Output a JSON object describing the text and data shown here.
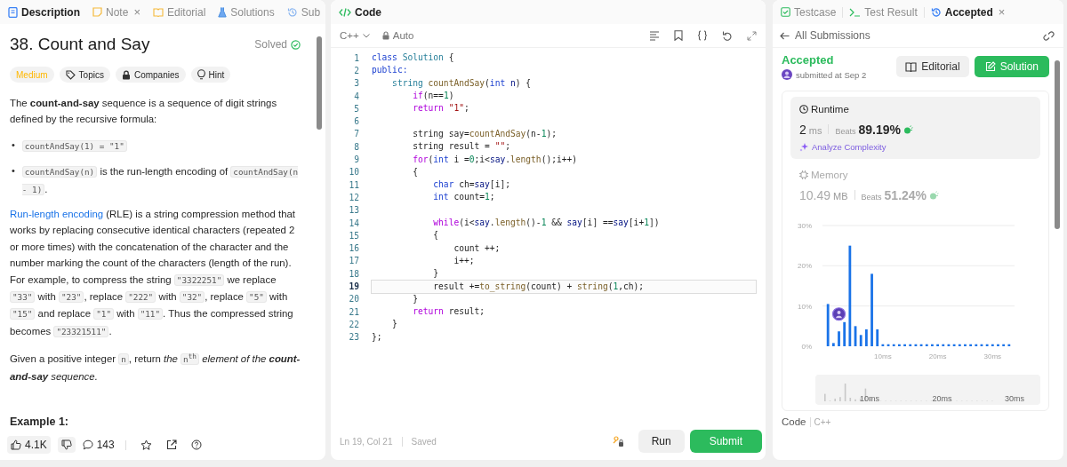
{
  "left_tabs": [
    {
      "kind": "description",
      "label": "Description",
      "selected": true
    },
    {
      "kind": "note",
      "label": "Note",
      "selected": false,
      "close": "×"
    },
    {
      "kind": "editorial",
      "label": "Editorial",
      "selected": false
    },
    {
      "kind": "solutions",
      "label": "Solutions",
      "selected": false
    },
    {
      "kind": "submissions",
      "label": "Sub",
      "selected": false
    }
  ],
  "problem": {
    "title": "38. Count and Say",
    "status": "Solved",
    "tags": [
      {
        "kind": "difficulty",
        "label": "Medium"
      },
      {
        "kind": "topics",
        "label": "Topics"
      },
      {
        "kind": "companies",
        "label": "Companies"
      },
      {
        "kind": "hint",
        "label": "Hint"
      }
    ],
    "intro": [
      {
        "kind": "text",
        "text": "The **count-and-say** sequence is a sequence of digit strings defined by the recursive formula:"
      }
    ],
    "bullets": [
      {
        "marker": "•",
        "segments": [
          {
            "kind": "code",
            "text": "countAndSay(1) = \"1\""
          }
        ]
      },
      {
        "marker": "•",
        "segments": [
          {
            "kind": "code",
            "text": "countAndSay(n)"
          },
          {
            "kind": "text",
            "text": " is the run-length encoding of "
          },
          {
            "kind": "code",
            "text": "countAndSay(n - 1)"
          },
          {
            "kind": "text",
            "text": "."
          }
        ]
      }
    ],
    "paragraphs": [
      [
        {
          "kind": "link",
          "text": "Run-length encoding"
        },
        {
          "kind": "text",
          "text": " (RLE) is a string compression method that works by replacing consecutive identical characters (repeated 2 or more times) with the concatenation of the character and the number marking the count of the characters (length of the run). For example, to compress the string "
        },
        {
          "kind": "code",
          "text": "\"3322251\""
        },
        {
          "kind": "text",
          "text": " we replace "
        },
        {
          "kind": "code",
          "text": "\"33\""
        },
        {
          "kind": "text",
          "text": " with "
        },
        {
          "kind": "code",
          "text": "\"23\""
        },
        {
          "kind": "text",
          "text": ", replace "
        },
        {
          "kind": "code",
          "text": "\"222\""
        },
        {
          "kind": "text",
          "text": " with "
        },
        {
          "kind": "code",
          "text": "\"32\""
        },
        {
          "kind": "text",
          "text": ", replace "
        },
        {
          "kind": "code",
          "text": "\"5\""
        },
        {
          "kind": "text",
          "text": " with "
        },
        {
          "kind": "code",
          "text": "\"15\""
        },
        {
          "kind": "text",
          "text": " and replace "
        },
        {
          "kind": "code",
          "text": "\"1\""
        },
        {
          "kind": "text",
          "text": " with "
        },
        {
          "kind": "code",
          "text": "\"11\""
        },
        {
          "kind": "text",
          "text": ". Thus the compressed string becomes "
        },
        {
          "kind": "code",
          "text": "\"23321511\""
        },
        {
          "kind": "text",
          "text": "."
        }
      ],
      [
        {
          "kind": "text",
          "text": "Given a positive integer "
        },
        {
          "kind": "code",
          "text": "n"
        },
        {
          "kind": "text",
          "text": ", return "
        },
        {
          "kind": "italic",
          "text": "the "
        },
        {
          "kind": "code",
          "text": "n$^{th}$"
        },
        {
          "kind": "italic",
          "text": " element of the **count-and-say** sequence."
        }
      ]
    ],
    "example_heading": "Example 1:"
  },
  "left_footer": [
    {
      "kind": "like",
      "count": "4.1K"
    },
    {
      "kind": "dislike"
    },
    {
      "kind": "comment",
      "count": "143"
    },
    {
      "kind": "star"
    },
    {
      "kind": "share"
    },
    {
      "kind": "help"
    }
  ],
  "code_panel": {
    "title": "Code",
    "language": "C++",
    "mode": "Auto",
    "lines": [
      {
        "number": "1",
        "current": false,
        "tokens": [
          {
            "kind": "kw",
            "text": "class"
          },
          {
            "kind": "type",
            "text": " Solution"
          },
          {
            "kind": "plain",
            "text": " {"
          }
        ]
      },
      {
        "number": "2",
        "current": false,
        "tokens": [
          {
            "kind": "kw",
            "text": "public:"
          }
        ]
      },
      {
        "number": "3",
        "current": false,
        "tokens": [
          {
            "kind": "type",
            "text": "    string"
          },
          {
            "kind": "fn",
            "text": " countAndSay"
          },
          {
            "kind": "plain",
            "text": "("
          },
          {
            "kind": "kw",
            "text": "int"
          },
          {
            "kind": "var",
            "text": " n"
          },
          {
            "kind": "plain",
            "text": ") {"
          }
        ]
      },
      {
        "number": "4",
        "current": false,
        "tokens": [
          {
            "kind": "ctrl",
            "text": "        if"
          },
          {
            "kind": "plain",
            "text": "(n=="
          },
          {
            "kind": "num",
            "text": "1"
          },
          {
            "kind": "plain",
            "text": ")"
          }
        ]
      },
      {
        "number": "5",
        "current": false,
        "tokens": [
          {
            "kind": "ctrl",
            "text": "        return"
          },
          {
            "kind": "str",
            "text": " \"1\""
          },
          {
            "kind": "plain",
            "text": ";"
          }
        ]
      },
      {
        "number": "6",
        "current": false
      },
      {
        "number": "7",
        "current": false,
        "tokens": [
          {
            "kind": "plain",
            "text": "        string say="
          },
          {
            "kind": "fn",
            "text": "countAndSay"
          },
          {
            "kind": "plain",
            "text": "(n-"
          },
          {
            "kind": "num",
            "text": "1"
          },
          {
            "kind": "plain",
            "text": ");"
          }
        ]
      },
      {
        "number": "8",
        "current": false,
        "tokens": [
          {
            "kind": "plain",
            "text": "        string result = "
          },
          {
            "kind": "str",
            "text": "\"\""
          },
          {
            "kind": "plain",
            "text": ";"
          }
        ]
      },
      {
        "number": "9",
        "current": false,
        "tokens": [
          {
            "kind": "ctrl",
            "text": "        for"
          },
          {
            "kind": "plain",
            "text": "("
          },
          {
            "kind": "kw",
            "text": "int"
          },
          {
            "kind": "plain",
            "text": " i ="
          },
          {
            "kind": "num",
            "text": "0"
          },
          {
            "kind": "plain",
            "text": ";i<"
          },
          {
            "kind": "var",
            "text": "say"
          },
          {
            "kind": "plain",
            "text": "."
          },
          {
            "kind": "fn",
            "text": "length"
          },
          {
            "kind": "plain",
            "text": "();i++)"
          }
        ]
      },
      {
        "number": "10",
        "current": false,
        "tokens": [
          {
            "kind": "plain",
            "text": "        {"
          }
        ]
      },
      {
        "number": "11",
        "current": false,
        "tokens": [
          {
            "kind": "kw",
            "text": "            char"
          },
          {
            "kind": "plain",
            "text": " ch="
          },
          {
            "kind": "var",
            "text": "say"
          },
          {
            "kind": "plain",
            "text": "[i];"
          }
        ]
      },
      {
        "number": "12",
        "current": false,
        "tokens": [
          {
            "kind": "kw",
            "text": "            int"
          },
          {
            "kind": "plain",
            "text": " count="
          },
          {
            "kind": "num",
            "text": "1"
          },
          {
            "kind": "plain",
            "text": ";"
          }
        ]
      },
      {
        "number": "13",
        "current": false
      },
      {
        "number": "14",
        "current": false,
        "tokens": [
          {
            "kind": "ctrl",
            "text": "            while"
          },
          {
            "kind": "plain",
            "text": "(i<"
          },
          {
            "kind": "var",
            "text": "say"
          },
          {
            "kind": "plain",
            "text": "."
          },
          {
            "kind": "fn",
            "text": "length"
          },
          {
            "kind": "plain",
            "text": "()-"
          },
          {
            "kind": "num",
            "text": "1"
          },
          {
            "kind": "plain",
            "text": " && "
          },
          {
            "kind": "var",
            "text": "say"
          },
          {
            "kind": "plain",
            "text": "[i] =="
          },
          {
            "kind": "var",
            "text": "say"
          },
          {
            "kind": "plain",
            "text": "[i+"
          },
          {
            "kind": "num",
            "text": "1"
          },
          {
            "kind": "plain",
            "text": "])"
          }
        ]
      },
      {
        "number": "15",
        "current": false,
        "tokens": [
          {
            "kind": "plain",
            "text": "            {"
          }
        ]
      },
      {
        "number": "16",
        "current": false,
        "tokens": [
          {
            "kind": "plain",
            "text": "                count ++;"
          }
        ]
      },
      {
        "number": "17",
        "current": false,
        "tokens": [
          {
            "kind": "plain",
            "text": "                i++;"
          }
        ]
      },
      {
        "number": "18",
        "current": false,
        "tokens": [
          {
            "kind": "plain",
            "text": "            }"
          }
        ]
      },
      {
        "number": "19",
        "current": true,
        "tokens": [
          {
            "kind": "plain",
            "text": "            result +="
          },
          {
            "kind": "fn",
            "text": "to_string"
          },
          {
            "kind": "plain",
            "text": "(count) + "
          },
          {
            "kind": "fn",
            "text": "string"
          },
          {
            "kind": "plain",
            "text": "("
          },
          {
            "kind": "num",
            "text": "1"
          },
          {
            "kind": "plain",
            "text": ",ch);"
          }
        ]
      },
      {
        "number": "20",
        "current": false,
        "tokens": [
          {
            "kind": "plain",
            "text": "        }"
          }
        ]
      },
      {
        "number": "21",
        "current": false,
        "tokens": [
          {
            "kind": "ctrl",
            "text": "        return"
          },
          {
            "kind": "plain",
            "text": " result;"
          }
        ]
      },
      {
        "number": "22",
        "current": false,
        "tokens": [
          {
            "kind": "plain",
            "text": "    }"
          }
        ]
      },
      {
        "number": "23",
        "current": false,
        "tokens": [
          {
            "kind": "plain",
            "text": "};"
          }
        ]
      }
    ],
    "cursor": "Ln 19, Col 21",
    "save_state": "Saved",
    "run_label": "Run",
    "submit_label": "Submit"
  },
  "right_tabs": [
    {
      "kind": "testcase",
      "label": "Testcase",
      "selected": false
    },
    {
      "kind": "result",
      "label": "Test Result",
      "selected": false
    },
    {
      "kind": "accepted",
      "label": "Accepted",
      "selected": true,
      "close": "×"
    }
  ],
  "submission": {
    "back_label": "All Submissions",
    "status": "Accepted",
    "submitted": "submitted at Sep 2",
    "editorial_label": "Editorial",
    "solution_label": "Solution",
    "metrics": [
      {
        "kind": "runtime",
        "label": "Runtime",
        "value": "2",
        "unit": "ms",
        "beats_label": "Beats",
        "beats": "89.19%",
        "selected": true,
        "action": "Analyze Complexity"
      },
      {
        "kind": "memory",
        "label": "Memory",
        "value": "10.49",
        "unit": "MB",
        "beats_label": "Beats",
        "beats": "51.24%",
        "selected": false
      }
    ],
    "chart_data": {
      "type": "bar",
      "x": [
        0,
        1,
        2,
        3,
        4,
        5,
        6,
        7,
        8,
        9,
        10,
        11,
        12,
        13,
        14,
        15,
        16,
        17,
        18,
        19,
        20,
        21,
        22,
        23,
        24,
        25,
        26,
        27,
        28,
        29,
        30,
        31,
        32,
        33
      ],
      "values": [
        10.5,
        0.8,
        3.7,
        6,
        25,
        5,
        2.8,
        4.2,
        18,
        4.2,
        0.5,
        0.5,
        0.5,
        0.5,
        0.5,
        0.5,
        0.5,
        0.5,
        0.5,
        0.5,
        0.5,
        0.5,
        0.5,
        0.5,
        0.5,
        0.5,
        0.5,
        0.5,
        0.5,
        0.5,
        0.5,
        0.5,
        0.5,
        0.5
      ],
      "ylim": [
        0,
        30
      ],
      "yticks": [
        {
          "value": 0,
          "label": "0%"
        },
        {
          "value": 10,
          "label": "10%"
        },
        {
          "value": 20,
          "label": "20%"
        },
        {
          "value": 30,
          "label": "30%"
        }
      ],
      "xticks": [
        {
          "value": 10,
          "label": "10ms"
        },
        {
          "value": 20,
          "label": "20ms"
        },
        {
          "value": 30,
          "label": "30ms"
        }
      ],
      "xlim": [
        -1,
        34
      ]
    },
    "navigator_labels": [
      "10ms",
      "20ms",
      "30ms"
    ],
    "code_label": "Code",
    "code_language": "C++"
  }
}
